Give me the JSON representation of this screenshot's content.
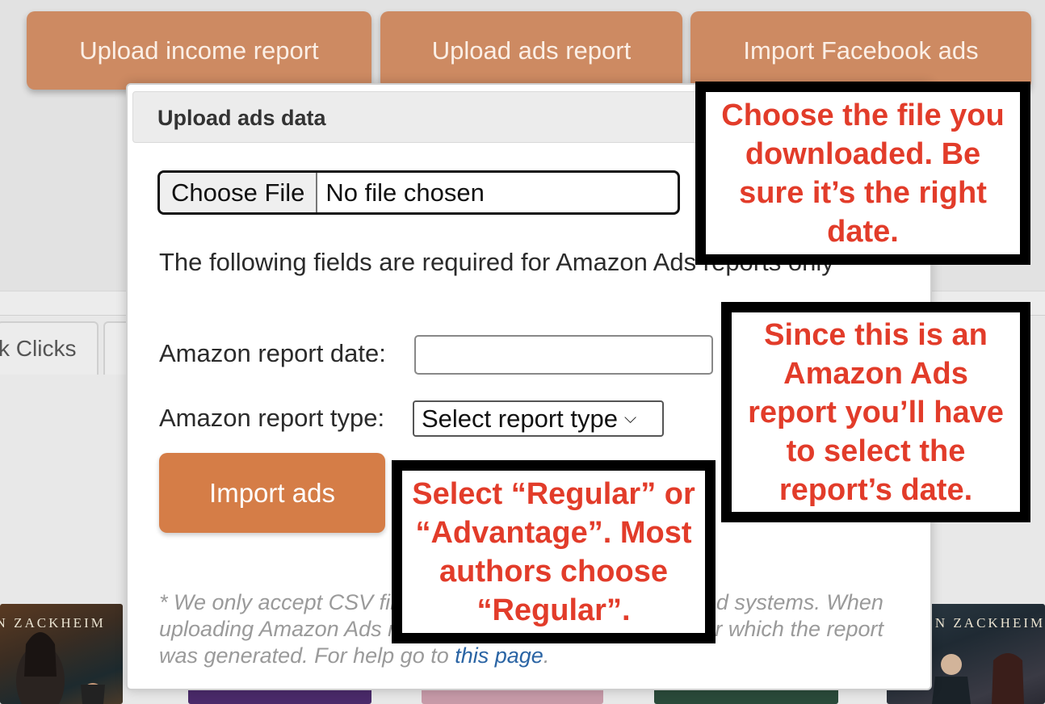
{
  "top_buttons": {
    "upload_income": "Upload income report",
    "upload_ads": "Upload ads report",
    "import_facebook": "Import Facebook ads"
  },
  "tabs": {
    "clicks_label": "k Clicks"
  },
  "modal": {
    "title": "Upload ads data",
    "file_button": "Choose File",
    "file_status": "No file chosen",
    "required_note": "The following fields are required for Amazon Ads reports only",
    "report_date_label": "Amazon report date:",
    "report_date_value": "",
    "report_type_label": "Amazon report type:",
    "report_type_selected": "Select report type",
    "import_button": "Import ads",
    "footnote_text": "* We only accept CSV files exported from the supported ad systems. When uploading Amazon Ads reports, please specify the date for which the report was generated. For help go to ",
    "footnote_link": "this page",
    "footnote_end": "."
  },
  "books": {
    "author_partial_1": "EN ZACKHEIM",
    "author_partial_2": "N ZACKHEIM"
  },
  "callouts": {
    "file": "Choose the file you downloaded. Be sure it’s the right date.",
    "date": "Since this is an Amazon Ads report you’ll have to select the report’s date.",
    "type": "Select “Regular” or “Advantage”. Most authors choose “Regular”."
  },
  "colors": {
    "top_button": "#cd8a62",
    "import_button": "#d57d47",
    "callout_text": "#e23c2a",
    "link": "#2a64a4"
  }
}
